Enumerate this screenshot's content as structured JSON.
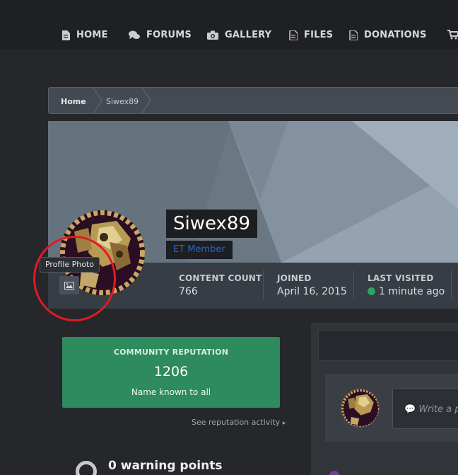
{
  "nav": {
    "items": [
      {
        "label": "HOME",
        "icon": "document-icon"
      },
      {
        "label": "FORUMS",
        "icon": "chat-bubbles-icon"
      },
      {
        "label": "GALLERY",
        "icon": "camera-icon"
      },
      {
        "label": "FILES",
        "icon": "file-icon"
      },
      {
        "label": "DONATIONS",
        "icon": "file-icon"
      }
    ],
    "cart_icon": "cart-icon"
  },
  "breadcrumb": {
    "home": "Home",
    "current": "Siwex89"
  },
  "profile": {
    "username": "Siwex89",
    "group": "ET Member",
    "tooltip": "Profile Photo",
    "stats": [
      {
        "label": "CONTENT COUNT",
        "value": "766"
      },
      {
        "label": "JOINED",
        "value": "April 16, 2015"
      },
      {
        "label": "LAST VISITED",
        "value": "1 minute ago"
      }
    ]
  },
  "reputation": {
    "title": "COMMUNITY REPUTATION",
    "value": "1206",
    "description": "Name known to all",
    "link": "See reputation activity"
  },
  "warnings": {
    "text": "0 warning points"
  },
  "status_box": {
    "placeholder": "Write a p"
  },
  "colors": {
    "accent_green": "#2e8a5f",
    "group_blue": "#2a64c8",
    "online_green": "#2fa362",
    "annotation_red": "#e01b22"
  }
}
